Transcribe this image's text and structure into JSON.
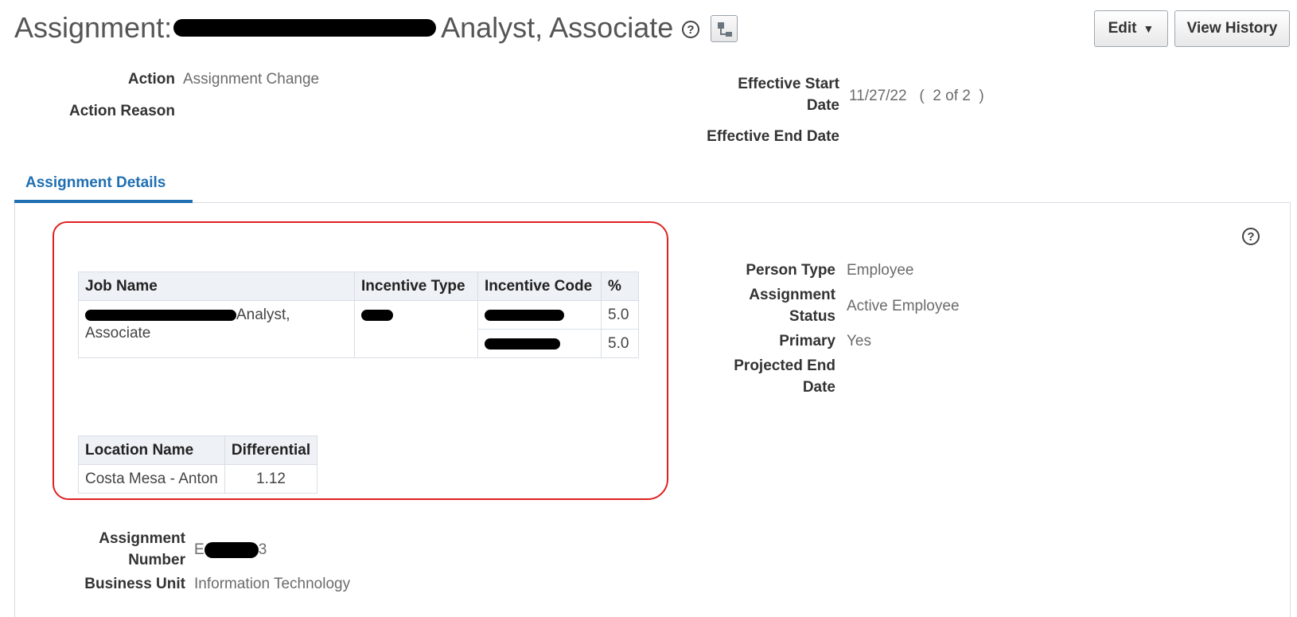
{
  "header": {
    "title_prefix": "Assignment:",
    "title_suffix": "Analyst, Associate",
    "help_glyph": "?",
    "edit_label": "Edit",
    "edit_caret": "▼",
    "history_label": "View History"
  },
  "summary": {
    "action_label": "Action",
    "action_value": "Assignment Change",
    "action_reason_label": "Action Reason",
    "effective_start_label_1": "Effective Start",
    "effective_start_label_2": "Date",
    "effective_start_value": "11/27/22",
    "record_count": "(  2 of 2  )",
    "effective_end_label": "Effective End Date"
  },
  "tabs": [
    {
      "label": "Assignment Details",
      "active": true
    }
  ],
  "job_table": {
    "headers": [
      "Job Name",
      "Incentive Type",
      "Incentive Code",
      "%"
    ],
    "job_name_visible": "Analyst,",
    "job_name_line2": "Associate",
    "percents": [
      "5.0",
      "5.0"
    ]
  },
  "location_table": {
    "headers": [
      "Location Name",
      "Differential"
    ],
    "rows": [
      [
        "Costa Mesa - Anton",
        "1.12"
      ]
    ]
  },
  "person": {
    "person_type_label": "Person Type",
    "person_type_value": "Employee",
    "assignment_status_label_1": "Assignment",
    "assignment_status_label_2": "Status",
    "assignment_status_value": "Active Employee",
    "primary_label": "Primary",
    "primary_value": "Yes",
    "projected_end_label_1": "Projected End",
    "projected_end_label_2": "Date"
  },
  "bottom": {
    "assignment_number_label_1": "Assignment",
    "assignment_number_label_2": "Number",
    "assignment_number_prefix": "E",
    "assignment_number_suffix": "3",
    "business_unit_label": "Business Unit",
    "business_unit_value": "Information Technology"
  },
  "colors": {
    "tab_accent": "#1f6fb2",
    "annotation": "#e02020"
  }
}
